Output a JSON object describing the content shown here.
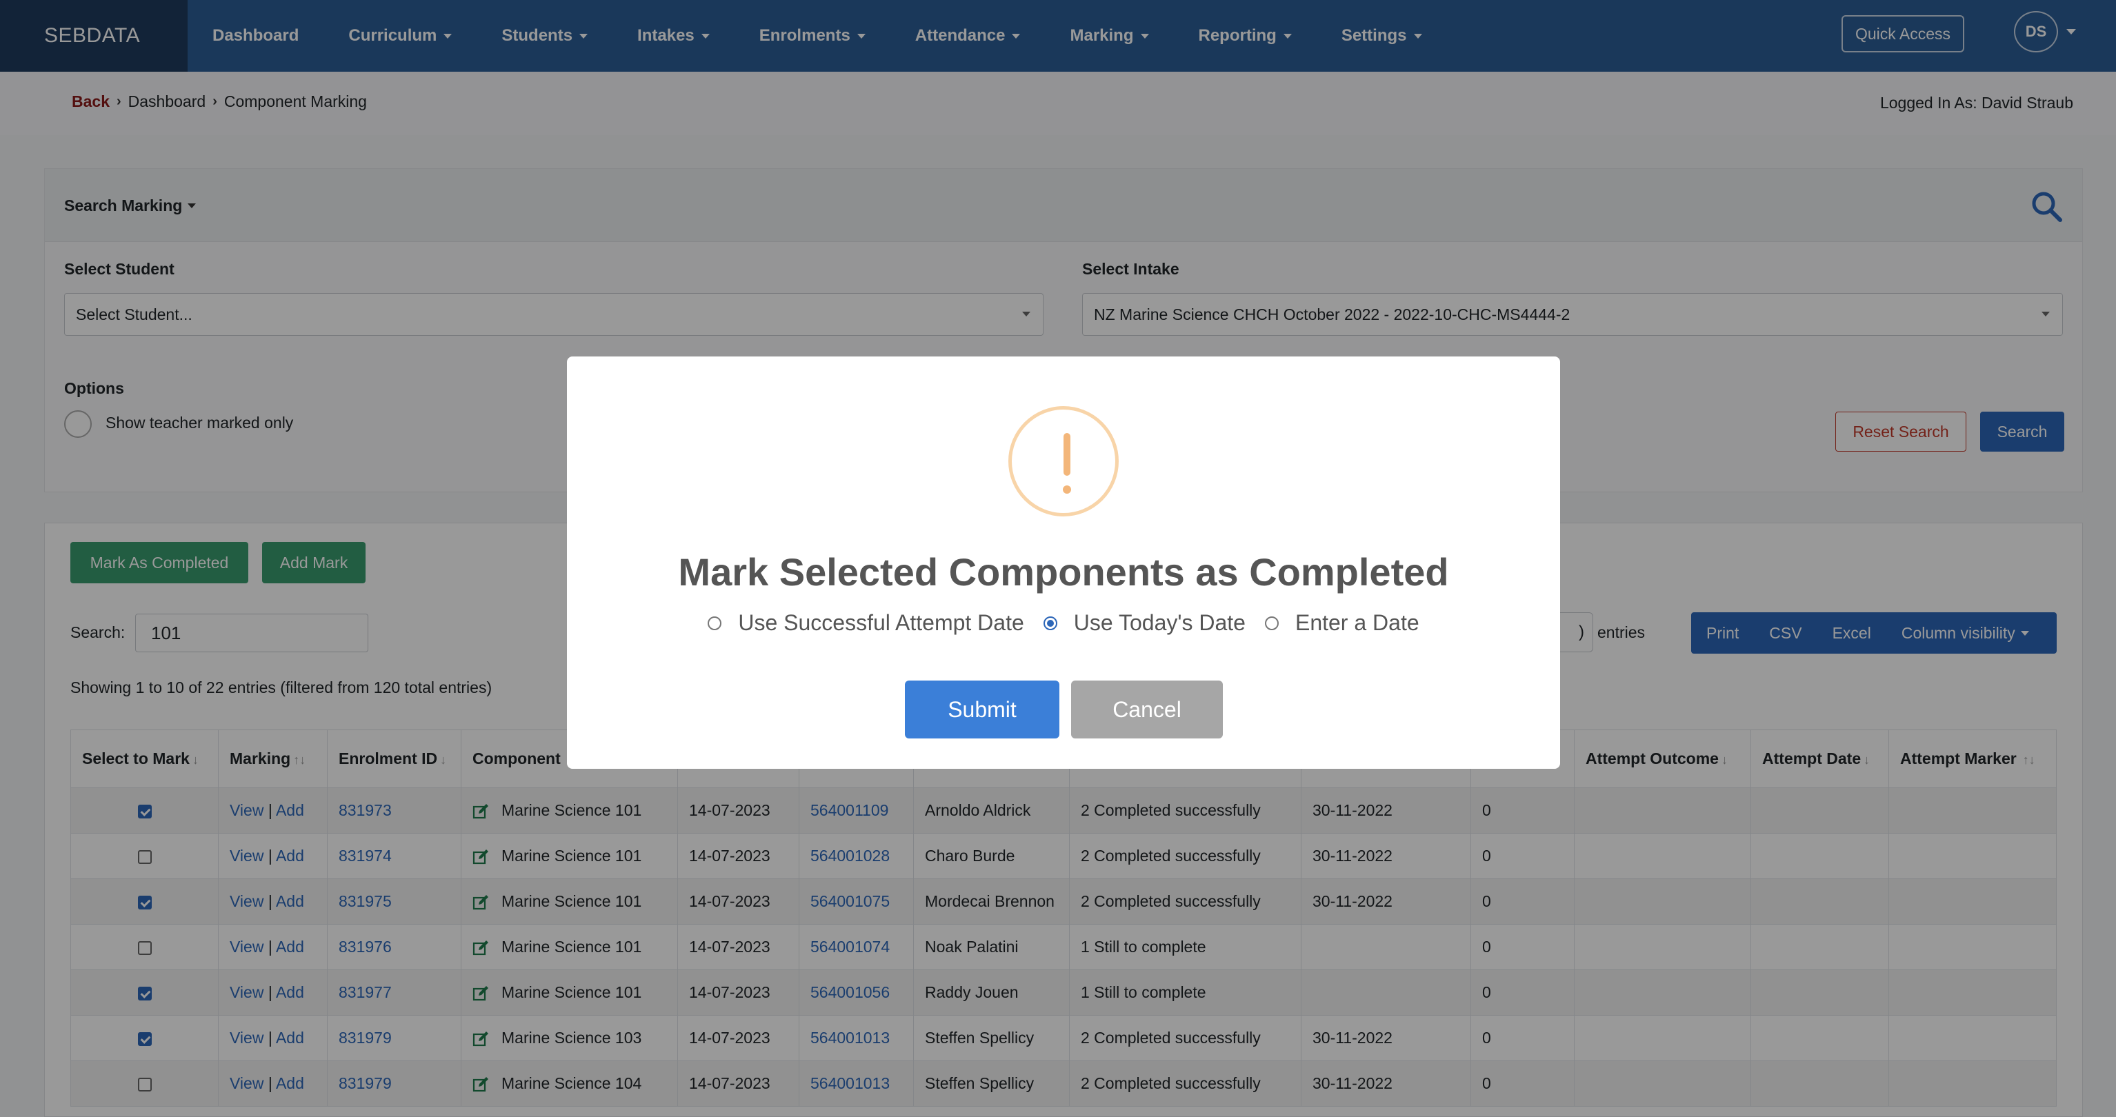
{
  "navbar": {
    "brand": "SEBDATA",
    "items": [
      {
        "label": "Dashboard",
        "dropdown": false
      },
      {
        "label": "Curriculum",
        "dropdown": true
      },
      {
        "label": "Students",
        "dropdown": true
      },
      {
        "label": "Intakes",
        "dropdown": true
      },
      {
        "label": "Enrolments",
        "dropdown": true
      },
      {
        "label": "Attendance",
        "dropdown": true
      },
      {
        "label": "Marking",
        "dropdown": true
      },
      {
        "label": "Reporting",
        "dropdown": true
      },
      {
        "label": "Settings",
        "dropdown": true
      }
    ],
    "quick_access": "Quick Access",
    "avatar_initials": "DS"
  },
  "breadcrumb": {
    "back": "Back",
    "items": [
      "Dashboard",
      "Component Marking"
    ],
    "logged_in": "Logged In As: David Straub"
  },
  "search_panel": {
    "title": "Search Marking",
    "student_label": "Select Student",
    "student_value": "Select Student...",
    "intake_label": "Select Intake",
    "intake_value": "NZ Marine Science CHCH October 2022 - 2022-10-CHC-MS4444-2",
    "options_label": "Options",
    "option_teacher": "Show teacher marked only",
    "reset_button": "Reset Search",
    "search_button": "Search"
  },
  "results": {
    "mark_completed": "Mark As Completed",
    "add_mark": "Add Mark",
    "search_label": "Search:",
    "search_value": "101",
    "entries_fragment": ")",
    "entries_label": "entries",
    "showing": "Showing 1 to 10 of 22 entries (filtered from 120 total entries)",
    "export": {
      "print": "Print",
      "csv": "CSV",
      "excel": "Excel",
      "column_visibility": "Column visibility"
    },
    "columns": [
      "Select to Mark",
      "Marking",
      "Enrolment ID",
      "Component",
      "",
      "",
      "",
      "",
      "",
      "",
      "Attempt Outcome",
      "Attempt Date",
      "Attempt Marker"
    ],
    "rows": [
      {
        "checked": true,
        "view": "View",
        "add": "Add",
        "enrolment_id": "831973",
        "component": "Marine Science 101",
        "date": "14-07-2023",
        "student_id": "564001109",
        "name": "Arnoldo Aldrick",
        "status": "2 Completed successfully",
        "completed_date": "30-11-2022",
        "count": "0"
      },
      {
        "checked": false,
        "view": "View",
        "add": "Add",
        "enrolment_id": "831974",
        "component": "Marine Science 101",
        "date": "14-07-2023",
        "student_id": "564001028",
        "name": "Charo Burde",
        "status": "2 Completed successfully",
        "completed_date": "30-11-2022",
        "count": "0"
      },
      {
        "checked": true,
        "view": "View",
        "add": "Add",
        "enrolment_id": "831975",
        "component": "Marine Science 101",
        "date": "14-07-2023",
        "student_id": "564001075",
        "name": "Mordecai Brennon",
        "status": "2 Completed successfully",
        "completed_date": "30-11-2022",
        "count": "0"
      },
      {
        "checked": false,
        "view": "View",
        "add": "Add",
        "enrolment_id": "831976",
        "component": "Marine Science 101",
        "date": "14-07-2023",
        "student_id": "564001074",
        "name": "Noak Palatini",
        "status": "1 Still to complete",
        "completed_date": "",
        "count": "0"
      },
      {
        "checked": true,
        "view": "View",
        "add": "Add",
        "enrolment_id": "831977",
        "component": "Marine Science 101",
        "date": "14-07-2023",
        "student_id": "564001056",
        "name": "Raddy Jouen",
        "status": "1 Still to complete",
        "completed_date": "",
        "count": "0"
      },
      {
        "checked": true,
        "view": "View",
        "add": "Add",
        "enrolment_id": "831979",
        "component": "Marine Science 103",
        "date": "14-07-2023",
        "student_id": "564001013",
        "name": "Steffen Spellicy",
        "status": "2 Completed successfully",
        "completed_date": "30-11-2022",
        "count": "0"
      },
      {
        "checked": false,
        "view": "View",
        "add": "Add",
        "enrolment_id": "831979",
        "component": "Marine Science 104",
        "date": "14-07-2023",
        "student_id": "564001013",
        "name": "Steffen Spellicy",
        "status": "2 Completed successfully",
        "completed_date": "30-11-2022",
        "count": "0"
      }
    ]
  },
  "modal": {
    "icon": "warning-icon",
    "title": "Mark Selected Components as Completed",
    "options": [
      {
        "label": "Use Successful Attempt Date",
        "selected": false
      },
      {
        "label": "Use Today's Date",
        "selected": true
      },
      {
        "label": "Enter a Date",
        "selected": false
      }
    ],
    "submit": "Submit",
    "cancel": "Cancel"
  },
  "colors": {
    "navbar": "#2c5e96",
    "brand_bg": "#1f3b5e",
    "primary": "#2c66b8",
    "success": "#3a9b6e",
    "danger": "#c0392b",
    "warning": "#f3b67a"
  }
}
